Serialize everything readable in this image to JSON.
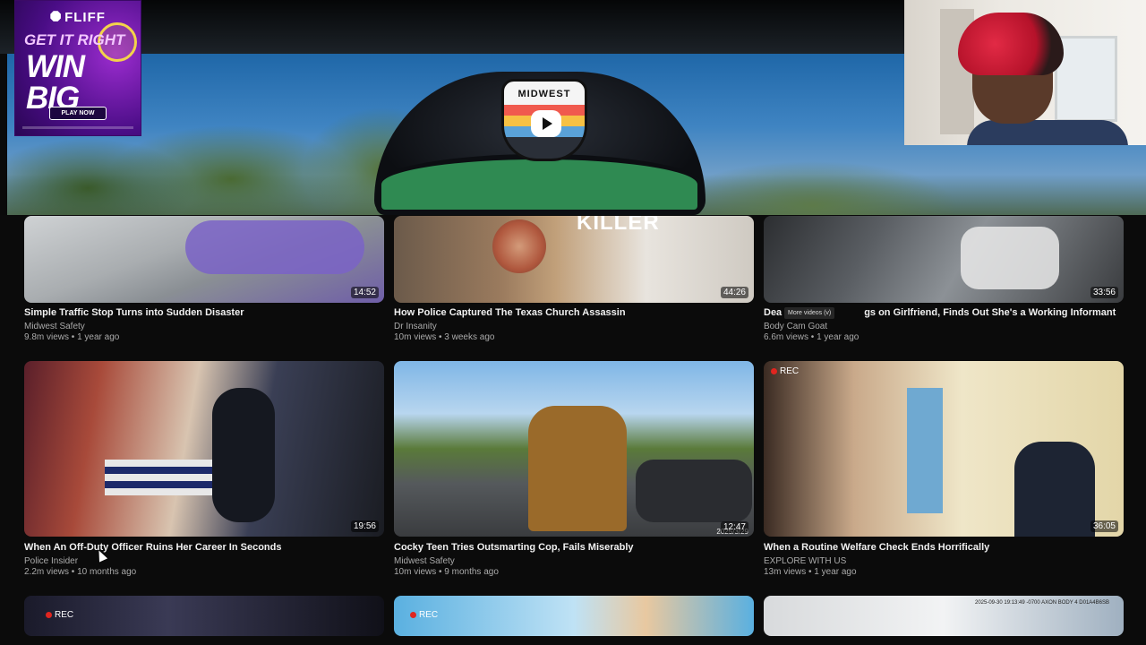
{
  "ad": {
    "brand": "FLIFF",
    "headline1": "GET IT RIGHT",
    "headline2": "WIN BIG",
    "cta": "PLAY NOW"
  },
  "hero": {
    "cap_text": "MIDWEST",
    "expand_icon": "chevron-down-icon"
  },
  "tooltip": "More videos (v)",
  "videos": [
    {
      "title": "Simple Traffic Stop Turns into Sudden Disaster",
      "channel": "Midwest Safety",
      "meta": "9.8m views • 1 year ago",
      "duration": "14:52"
    },
    {
      "title": "How Police Captured The Texas Church Assassin",
      "channel": "Dr Insanity",
      "meta": "10m views • 3 weeks ago",
      "duration": "44:26",
      "overlay": "KILLER"
    },
    {
      "title": "Dea",
      "title_tail": "gs on Girlfriend, Finds Out She's a Working Informant",
      "channel": "Body Cam Goat",
      "meta": "6.6m views • 1 year ago",
      "duration": "33:56"
    },
    {
      "title": "When An Off-Duty Officer Ruins Her Career In Seconds",
      "channel": "Police Insider",
      "meta": "2.2m views • 10 months ago",
      "duration": "19:56"
    },
    {
      "title": "Cocky Teen Tries Outsmarting Cop, Fails Miserably",
      "channel": "Midwest Safety",
      "meta": "10m views • 9 months ago",
      "duration": "12:47",
      "stamp": "2025/3/29"
    },
    {
      "title": "When a Routine Welfare Check Ends Horrifically",
      "channel": "EXPLORE WITH US",
      "meta": "13m views • 1 year ago",
      "duration": "36:05",
      "rec": "REC"
    },
    {
      "rec": "REC"
    },
    {
      "rec": "REC"
    },
    {
      "stamp": "2025-09-30 19:13:49 -0700 AXON BODY 4 D01A4B6SB"
    }
  ],
  "colors": {
    "accent_rec": "#e0251f",
    "ad_purple": "#4a0d86",
    "cap_brim": "#2f8a52"
  }
}
